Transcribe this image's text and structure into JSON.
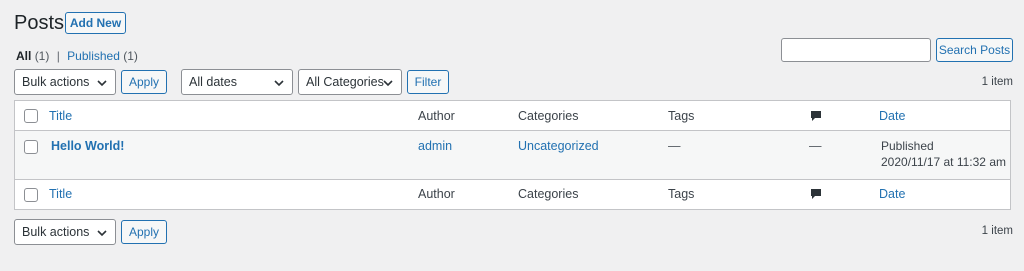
{
  "header": {
    "title": "Posts",
    "add_new_label": "Add New"
  },
  "views": {
    "all_label": "All",
    "all_count": "(1)",
    "separator": "|",
    "published_label": "Published",
    "published_count": "(1)"
  },
  "search": {
    "placeholder": "",
    "button_label": "Search Posts"
  },
  "top_nav": {
    "bulk_actions_value": "Bulk actions",
    "apply_label": "Apply",
    "dates_value": "All dates",
    "categories_value": "All Categories",
    "filter_label": "Filter",
    "items_count": "1 item"
  },
  "table": {
    "columns": {
      "title": "Title",
      "author": "Author",
      "categories": "Categories",
      "tags": "Tags",
      "date": "Date"
    },
    "rows": [
      {
        "title": "Hello World!",
        "author": "admin",
        "categories": "Uncategorized",
        "tags": "—",
        "comments": "—",
        "date_status": "Published",
        "date_value": "2020/11/17 at 11:32 am"
      }
    ]
  },
  "bottom_nav": {
    "bulk_actions_value": "Bulk actions",
    "apply_label": "Apply",
    "items_count": "1 item"
  },
  "colors": {
    "accent": "#2271b1",
    "background": "#f0f0f1",
    "border": "#c3c4c7"
  }
}
